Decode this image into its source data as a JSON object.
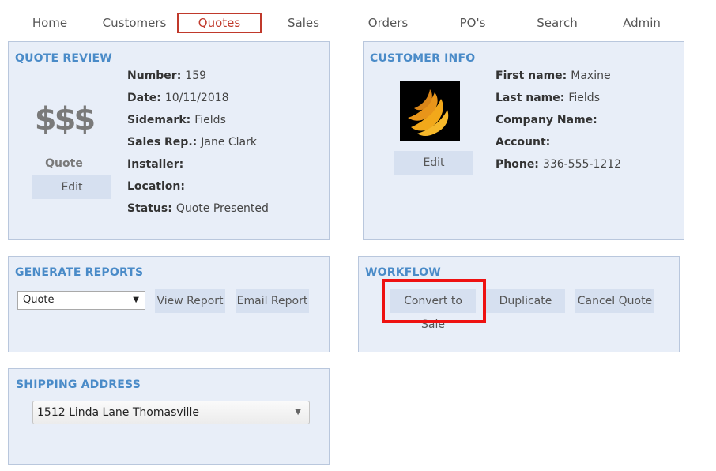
{
  "nav": {
    "items": [
      "Home",
      "Customers",
      "Quotes",
      "Sales",
      "Orders",
      "PO's",
      "Search",
      "Admin"
    ],
    "active": "Quotes"
  },
  "quote_review": {
    "title": "QUOTE REVIEW",
    "icon_text": "$$$",
    "icon_caption": "Quote",
    "edit_label": "Edit",
    "fields": [
      {
        "label": "Number:",
        "value": "159"
      },
      {
        "label": "Date:",
        "value": "10/11/2018"
      },
      {
        "label": "Sidemark:",
        "value": "Fields"
      },
      {
        "label": "Sales Rep.:",
        "value": "Jane Clark"
      },
      {
        "label": "Installer:",
        "value": ""
      },
      {
        "label": "Location:",
        "value": ""
      },
      {
        "label": "Status:",
        "value": "Quote Presented"
      }
    ]
  },
  "customer_info": {
    "title": "CUSTOMER INFO",
    "edit_label": "Edit",
    "fields": [
      {
        "label": "First name:",
        "value": "Maxine"
      },
      {
        "label": "Last name:",
        "value": "Fields"
      },
      {
        "label": "Company Name:",
        "value": ""
      },
      {
        "label": "Account:",
        "value": ""
      },
      {
        "label": "Phone:",
        "value": "336-555-1212"
      }
    ]
  },
  "generate_reports": {
    "title": "GENERATE REPORTS",
    "report_select": "Quote",
    "view_label": "View Report",
    "email_label": "Email Report"
  },
  "workflow": {
    "title": "WORKFLOW",
    "convert_label": "Convert to Sale",
    "duplicate_label": "Duplicate",
    "cancel_label": "Cancel Quote"
  },
  "shipping_address": {
    "title": "SHIPPING ADDRESS",
    "selected": "1512 Linda Lane Thomasville"
  },
  "colors": {
    "accent": "#4a8bc8",
    "panel_bg": "#e8eef8",
    "button_bg": "#d6e0f0",
    "active_nav": "#c0392b",
    "highlight": "#ee1111"
  }
}
